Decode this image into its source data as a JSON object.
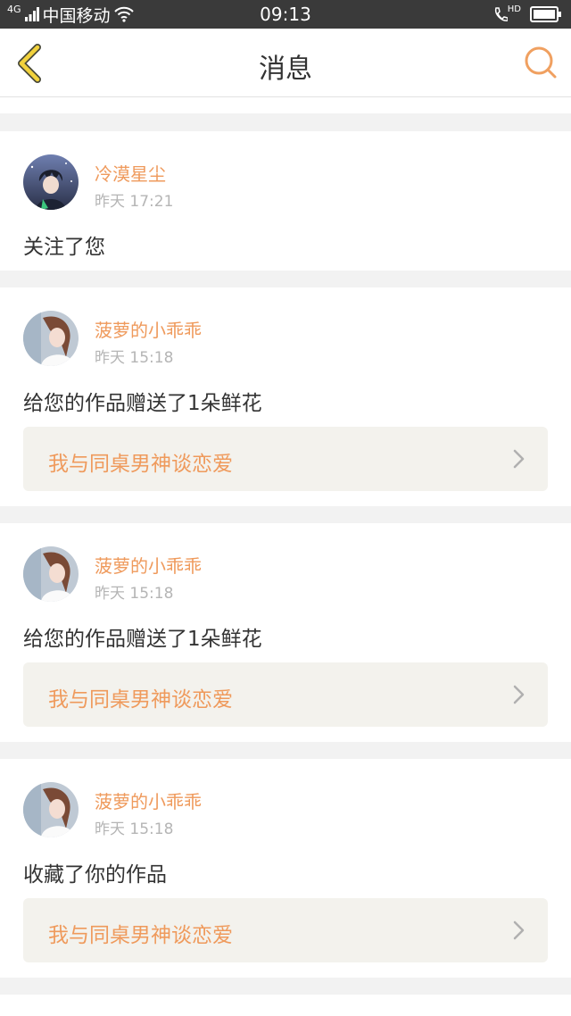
{
  "status_bar": {
    "network": "4G",
    "carrier": "中国移动",
    "time": "09:13",
    "call_badge": "HD"
  },
  "header": {
    "title": "消息",
    "back_icon": "chevron-left-icon",
    "search_icon": "search-icon",
    "accent_color": "#f0a060"
  },
  "messages": [
    {
      "user": "冷漠星尘",
      "time": "昨天 17:21",
      "action": "关注了您",
      "work": null
    },
    {
      "user": "菠萝的小乖乖",
      "time": "昨天 15:18",
      "action": "给您的作品赠送了1朵鲜花",
      "work": "我与同桌男神谈恋爱"
    },
    {
      "user": "菠萝的小乖乖",
      "time": "昨天 15:18",
      "action": "给您的作品赠送了1朵鲜花",
      "work": "我与同桌男神谈恋爱"
    },
    {
      "user": "菠萝的小乖乖",
      "time": "昨天 15:18",
      "action": "收藏了你的作品",
      "work": "我与同桌男神谈恋爱"
    }
  ],
  "colors": {
    "username": "#ef9a5c",
    "timestamp": "#b5b5b5",
    "link_bg": "#f3f2ed",
    "page_bg": "#f2f2f2"
  }
}
